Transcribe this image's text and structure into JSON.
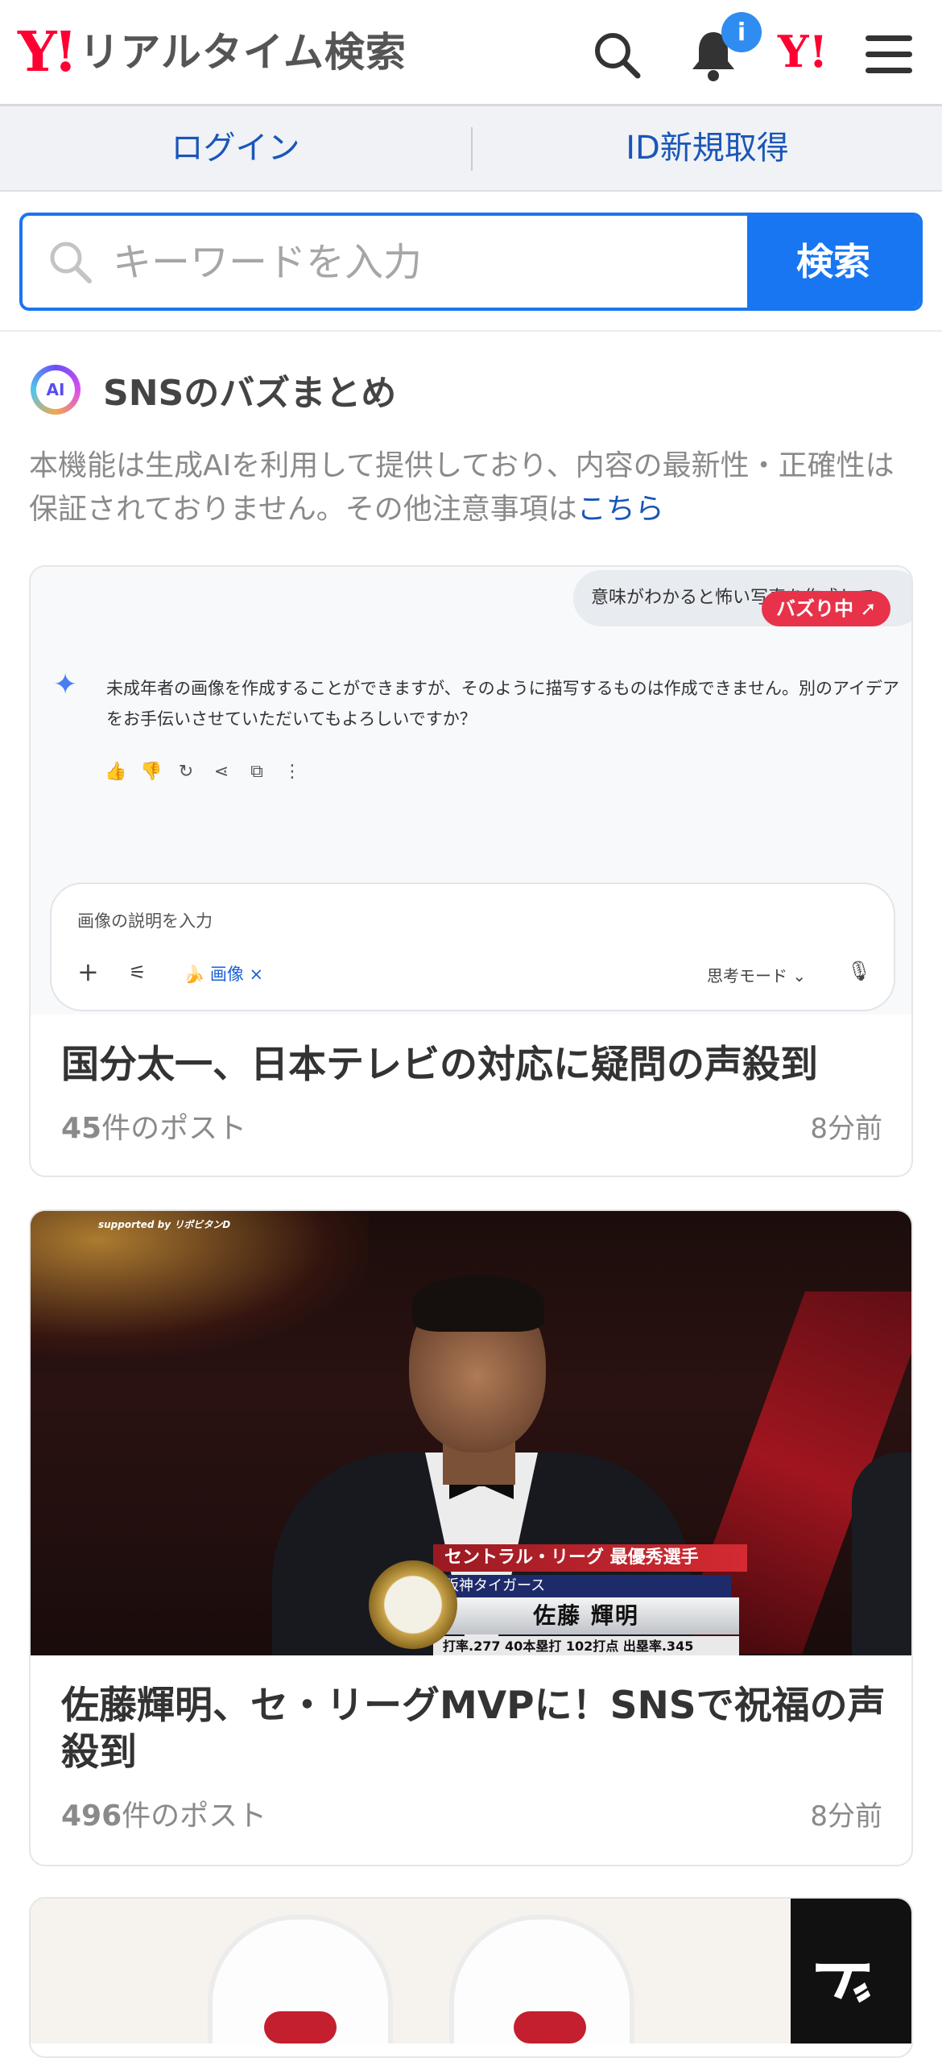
{
  "header": {
    "logo_y": "Y!",
    "title": "リアルタイム検索",
    "notification_badge": "i",
    "yahoo_mark": "Y!"
  },
  "login_bar": {
    "login": "ログイン",
    "signup": "ID新規取得"
  },
  "search": {
    "placeholder": "キーワードを入力",
    "button": "検索"
  },
  "section": {
    "ai_label": "AI",
    "title": "SNSのバズまとめ",
    "disclaimer": "本機能は生成AIを利用して提供しており、内容の最新性・正確性は保証されておりません。その他注意事項は",
    "disclaimer_link": "こちら"
  },
  "cards": [
    {
      "title": "国分太一、日本テレビの対応に疑問の声殺到",
      "count": "45",
      "count_suffix": "件のポスト",
      "ago": "8分前",
      "thumb": {
        "bubble": "意味がわかると怖い写真を作成して",
        "buzz": "バズり中",
        "response": "未成年者の画像を作成することができますが、そのように描写するものは作成できません。別のアイデアをお手伝いさせていただいてもよろしいですか？",
        "input_placeholder": "画像の説明を入力",
        "chip": "🍌 画像 ×",
        "mode": "思考モード ⌄"
      }
    },
    {
      "title": "佐藤輝明、セ・リーグMVPに！SNSで祝福の声殺到",
      "count": "496",
      "count_suffix": "件のポスト",
      "ago": "8分前",
      "thumb": {
        "sponsor": "supported by リポビタンD",
        "award": "セントラル・リーグ 最優秀選手",
        "team": "阪神タイガース",
        "name": "佐藤 輝明",
        "stats": "打率.277 40本塁打 102打点 出塁率.345"
      }
    },
    {
      "thumb": {
        "side_text": "ド"
      }
    }
  ]
}
